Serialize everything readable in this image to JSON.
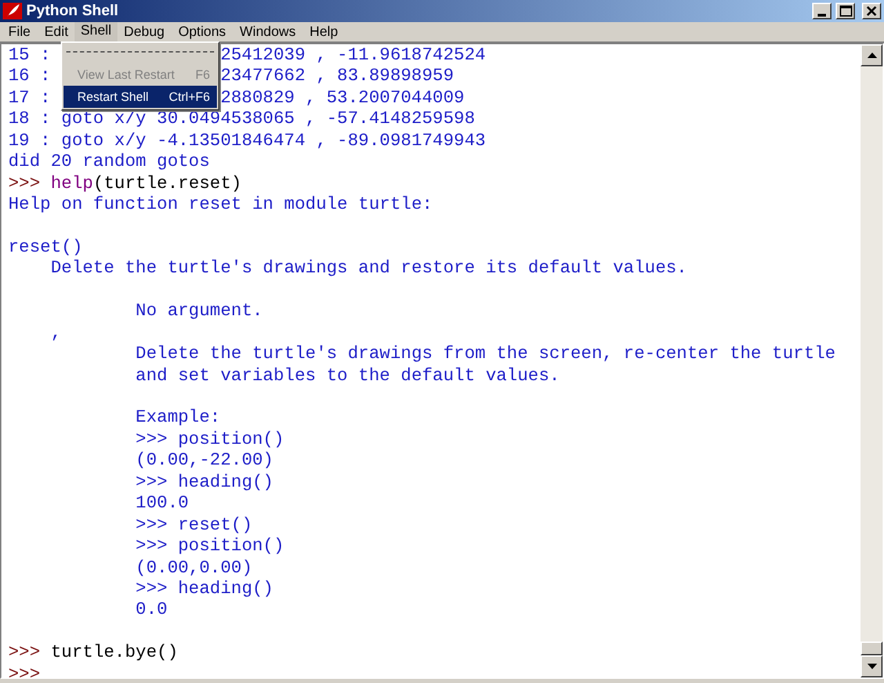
{
  "window": {
    "title": "Python Shell"
  },
  "menu_bar": [
    {
      "label": "File",
      "selected": false
    },
    {
      "label": "Edit",
      "selected": false
    },
    {
      "label": "Shell",
      "selected": true
    },
    {
      "label": "Debug",
      "selected": false
    },
    {
      "label": "Options",
      "selected": false
    },
    {
      "label": "Windows",
      "selected": false
    },
    {
      "label": "Help",
      "selected": false
    }
  ],
  "shell_menu": [
    {
      "kind": "tearoff"
    },
    {
      "kind": "item",
      "label": "View Last Restart",
      "shortcut": "F6",
      "disabled": true,
      "selected": false
    },
    {
      "kind": "item",
      "label": "Restart Shell",
      "shortcut": "Ctrl+F6",
      "disabled": false,
      "selected": true
    }
  ],
  "lines": [
    {
      "kind": "text",
      "segments": [
        {
          "text": "15 :",
          "kind": "output"
        },
        {
          "text": "25412039 , -11.9618742524",
          "kind": "output"
        }
      ]
    },
    {
      "kind": "text",
      "segments": [
        {
          "text": "16 :",
          "kind": "output"
        },
        {
          "text": "23477662 , 83.89898959",
          "kind": "output"
        }
      ]
    },
    {
      "kind": "text",
      "segments": [
        {
          "text": "17 :",
          "kind": "output"
        },
        {
          "text": "2880829 , 53.2007044009",
          "kind": "output"
        }
      ]
    },
    {
      "kind": "text",
      "segments": [
        {
          "text": "18 : goto x/y 30.0494538065 , -57.4148259598",
          "kind": "output"
        }
      ]
    },
    {
      "kind": "text",
      "segments": [
        {
          "text": "19 : goto x/y -4.13501846474 , -89.0981749943",
          "kind": "output"
        }
      ]
    },
    {
      "kind": "text",
      "segments": [
        {
          "text": "did 20 random gotos",
          "kind": "output"
        }
      ]
    },
    {
      "kind": "text",
      "segments": [
        {
          "text": ">>>",
          "kind": "prompt"
        },
        {
          "text": " help",
          "kind": "builtin"
        },
        {
          "text": "(turtle.reset)",
          "kind": "input"
        }
      ]
    },
    {
      "kind": "text",
      "segments": [
        {
          "text": "Help on function reset in module turtle:",
          "kind": "output"
        }
      ]
    },
    {
      "kind": "blank"
    },
    {
      "kind": "text",
      "segments": [
        {
          "text": "reset()",
          "kind": "output"
        }
      ]
    },
    {
      "kind": "text",
      "segments": [
        {
          "text": "    Delete the turtle's drawings and restore its default values.",
          "kind": "output"
        }
      ]
    },
    {
      "kind": "blank"
    },
    {
      "kind": "text",
      "segments": [
        {
          "text": "            No argument.",
          "kind": "output"
        }
      ]
    },
    {
      "kind": "text",
      "segments": [
        {
          "text": "    ,",
          "kind": "output"
        }
      ]
    },
    {
      "kind": "text",
      "segments": [
        {
          "text": "            Delete the turtle's drawings from the screen, re-center the turtle",
          "kind": "output"
        }
      ]
    },
    {
      "kind": "text",
      "segments": [
        {
          "text": "            and set variables to the default values.",
          "kind": "output"
        }
      ]
    },
    {
      "kind": "blank"
    },
    {
      "kind": "text",
      "segments": [
        {
          "text": "            Example:",
          "kind": "output"
        }
      ]
    },
    {
      "kind": "text",
      "segments": [
        {
          "text": "            >>> position()",
          "kind": "output"
        }
      ]
    },
    {
      "kind": "text",
      "segments": [
        {
          "text": "            (0.00,-22.00)",
          "kind": "output"
        }
      ]
    },
    {
      "kind": "text",
      "segments": [
        {
          "text": "            >>> heading()",
          "kind": "output"
        }
      ]
    },
    {
      "kind": "text",
      "segments": [
        {
          "text": "            100.0",
          "kind": "output"
        }
      ]
    },
    {
      "kind": "text",
      "segments": [
        {
          "text": "            >>> reset()",
          "kind": "output"
        }
      ]
    },
    {
      "kind": "text",
      "segments": [
        {
          "text": "            >>> position()",
          "kind": "output"
        }
      ]
    },
    {
      "kind": "text",
      "segments": [
        {
          "text": "            (0.00,0.00)",
          "kind": "output"
        }
      ]
    },
    {
      "kind": "text",
      "segments": [
        {
          "text": "            >>> heading()",
          "kind": "output"
        }
      ]
    },
    {
      "kind": "text",
      "segments": [
        {
          "text": "            0.0",
          "kind": "output"
        }
      ]
    },
    {
      "kind": "blank"
    },
    {
      "kind": "text",
      "segments": [
        {
          "text": ">>>",
          "kind": "prompt"
        },
        {
          "text": " turtle.bye()",
          "kind": "input"
        }
      ]
    },
    {
      "kind": "text",
      "segments": [
        {
          "text": ">>>",
          "kind": "prompt"
        }
      ]
    }
  ]
}
